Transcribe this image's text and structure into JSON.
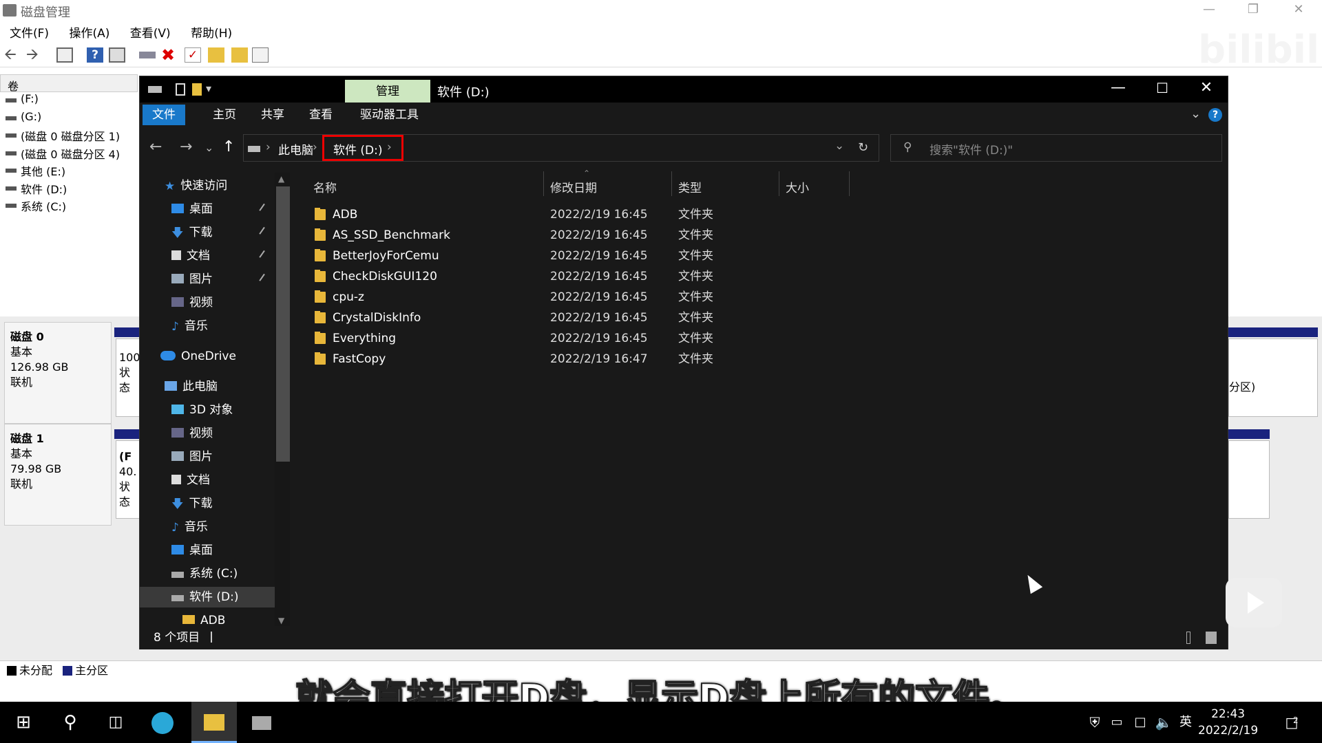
{
  "disk_mgmt": {
    "title": "磁盘管理",
    "menu": [
      "文件(F)",
      "操作(A)",
      "查看(V)",
      "帮助(H)"
    ],
    "list_header": "卷",
    "volumes": [
      "(F:)",
      "(G:)",
      "(磁盘 0 磁盘分区 1)",
      "(磁盘 0 磁盘分区 4)",
      "其他 (E:)",
      "软件 (D:)",
      "系统 (C:)"
    ],
    "disks": [
      {
        "name": "磁盘 0",
        "type": "基本",
        "size": "126.98 GB",
        "status": "联机",
        "partition_text": "100",
        "partition_text2": "状态"
      },
      {
        "name": "磁盘 1",
        "type": "基本",
        "size": "79.98 GB",
        "status": "联机",
        "partition_text": "(F",
        "partition_text2": "40.",
        "partition_text3": "状态"
      }
    ],
    "right_fragment": "分区)",
    "legend": {
      "unallocated": "未分配",
      "primary": "主分区",
      "unallocated_color": "#000000",
      "primary_color": "#1a237e"
    }
  },
  "explorer": {
    "title": "软件 (D:)",
    "context_tab": "管理",
    "ribbon_tabs": [
      "文件",
      "主页",
      "共享",
      "查看",
      "驱动器工具"
    ],
    "breadcrumb": {
      "root": "此电脑",
      "current": "软件 (D:)"
    },
    "search_placeholder": "搜索\"软件 (D:)\"",
    "nav": {
      "quick_access": "快速访问",
      "quick_items": [
        "桌面",
        "下载",
        "文档",
        "图片",
        "视频",
        "音乐"
      ],
      "onedrive": "OneDrive",
      "this_pc": "此电脑",
      "pc_items": [
        "3D 对象",
        "视频",
        "图片",
        "文档",
        "下载",
        "音乐",
        "桌面",
        "系统 (C:)",
        "软件 (D:)"
      ],
      "partial_item": "ADB"
    },
    "columns": {
      "name": "名称",
      "date": "修改日期",
      "type": "类型",
      "size": "大小"
    },
    "files": [
      {
        "name": "ADB",
        "date": "2022/2/19 16:45",
        "type": "文件夹"
      },
      {
        "name": "AS_SSD_Benchmark",
        "date": "2022/2/19 16:45",
        "type": "文件夹"
      },
      {
        "name": "BetterJoyForCemu",
        "date": "2022/2/19 16:45",
        "type": "文件夹"
      },
      {
        "name": "CheckDiskGUI120",
        "date": "2022/2/19 16:45",
        "type": "文件夹"
      },
      {
        "name": "cpu-z",
        "date": "2022/2/19 16:45",
        "type": "文件夹"
      },
      {
        "name": "CrystalDiskInfo",
        "date": "2022/2/19 16:45",
        "type": "文件夹"
      },
      {
        "name": "Everything",
        "date": "2022/2/19 16:45",
        "type": "文件夹"
      },
      {
        "name": "FastCopy",
        "date": "2022/2/19 16:47",
        "type": "文件夹"
      }
    ],
    "status": "8 个项目"
  },
  "subtitle": "就会直接打开D盘，显示D盘上所有的文件。",
  "taskbar": {
    "ime": "英",
    "time": "22:43",
    "date": "2022/2/19",
    "notifications": "2"
  }
}
